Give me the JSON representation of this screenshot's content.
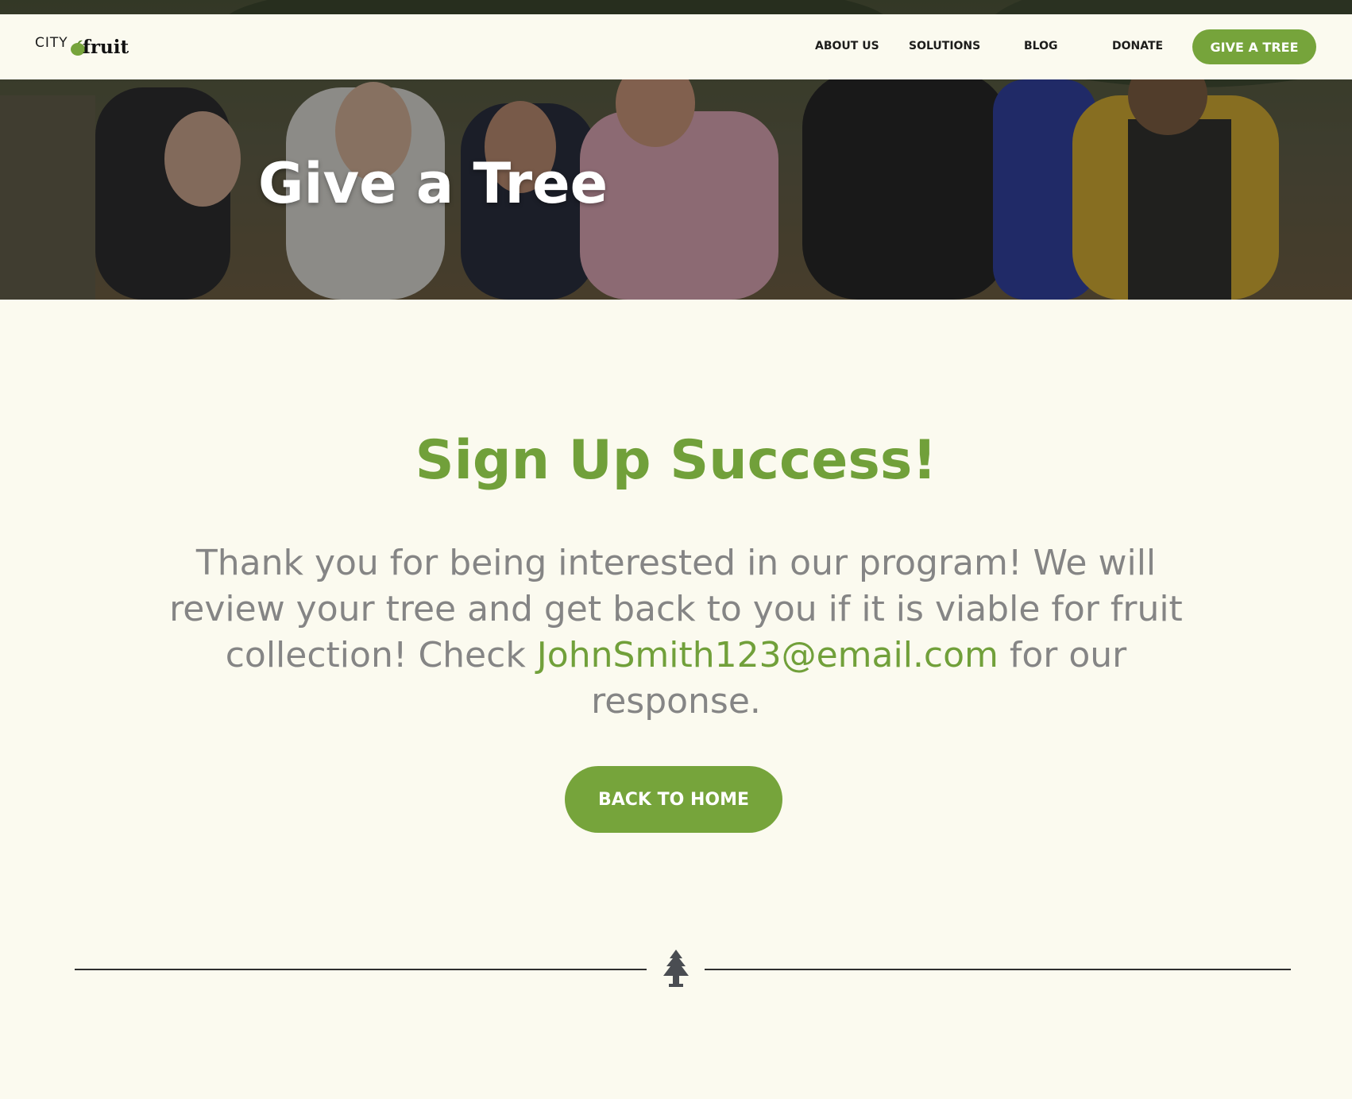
{
  "header": {
    "logo_city": "CITY",
    "logo_fruit": "fruit",
    "logo_icon": "apple-icon",
    "nav": [
      {
        "label": "ABOUT US"
      },
      {
        "label": "SOLUTIONS"
      },
      {
        "label": "BLOG"
      },
      {
        "label": "DONATE"
      }
    ],
    "cta_label": "GIVE A TREE"
  },
  "hero": {
    "title": "Give a Tree"
  },
  "main": {
    "title": "Sign Up Success!",
    "message_before": "Thank you for being interested in our program! We will review your tree and get back to you if it is viable for fruit collection! Check ",
    "email": "JohnSmith123@email.com",
    "message_after": " for our response.",
    "back_button_label": "BACK TO HOME"
  },
  "divider": {
    "icon": "tree-icon"
  },
  "colors": {
    "accent": "#76a43b",
    "title_green": "#71a03a",
    "body_text": "#858585",
    "background": "#fbfaef",
    "nav_text": "#1d1d1b"
  }
}
